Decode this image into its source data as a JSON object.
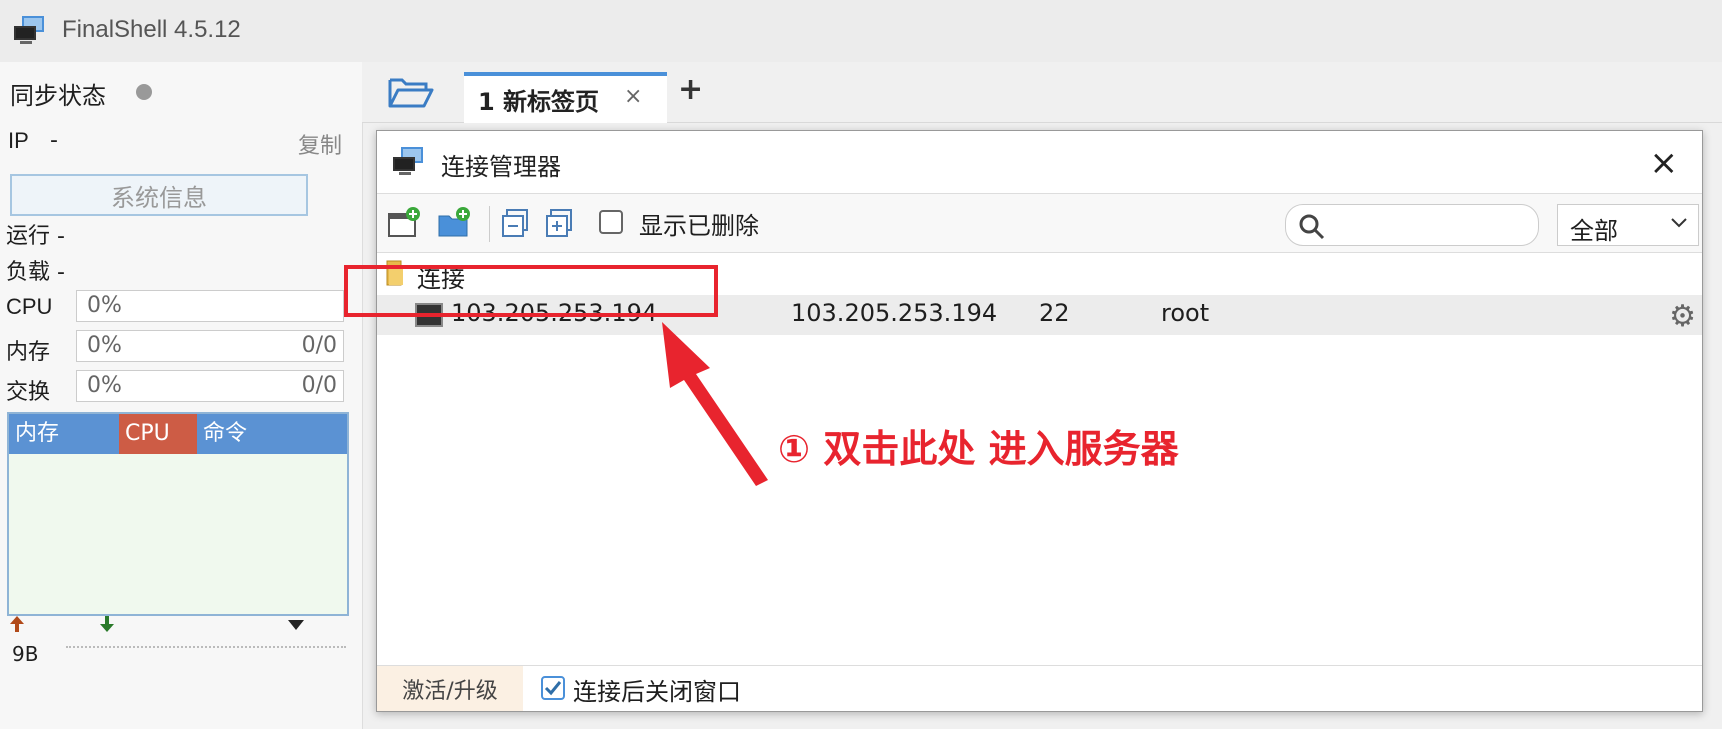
{
  "app": {
    "title": "FinalShell 4.5.12"
  },
  "left": {
    "sync_label": "同步状态",
    "ip_label": "IP",
    "ip_value": "-",
    "copy": "复制",
    "sysinfo": "系统信息",
    "run_label": "运行 -",
    "load_label": "负载 -",
    "cpu_label": "CPU",
    "cpu_pct": "0%",
    "mem_label": "内存",
    "mem_pct": "0%",
    "mem_val": "0/0",
    "swap_label": "交换",
    "swap_pct": "0%",
    "swap_val": "0/0",
    "monitor_tabs": [
      {
        "label": "内存",
        "color": "#5b92d3"
      },
      {
        "label": "CPU",
        "color": "#cd5c45"
      },
      {
        "label": "命令",
        "color": "#5b92d3"
      }
    ],
    "net_value": "9B"
  },
  "tabs": {
    "tab1_label": "1 新标签页",
    "close": "×",
    "add": "+"
  },
  "dialog": {
    "title": "连接管理器",
    "close": "×",
    "show_deleted": "显示已删除",
    "search_placeholder": "",
    "filter_value": "全部",
    "folder_name": "连接",
    "connection": {
      "name": "103.205.253.194",
      "host": "103.205.253.194",
      "port": "22",
      "user": "root"
    },
    "activate": "激活/升级",
    "close_after_connect": "连接后关闭窗口"
  },
  "annotation": {
    "text": "① 双击此处 进入服务器"
  },
  "colors": {
    "accent": "#4a90d9",
    "annotation": "#e8242e"
  }
}
